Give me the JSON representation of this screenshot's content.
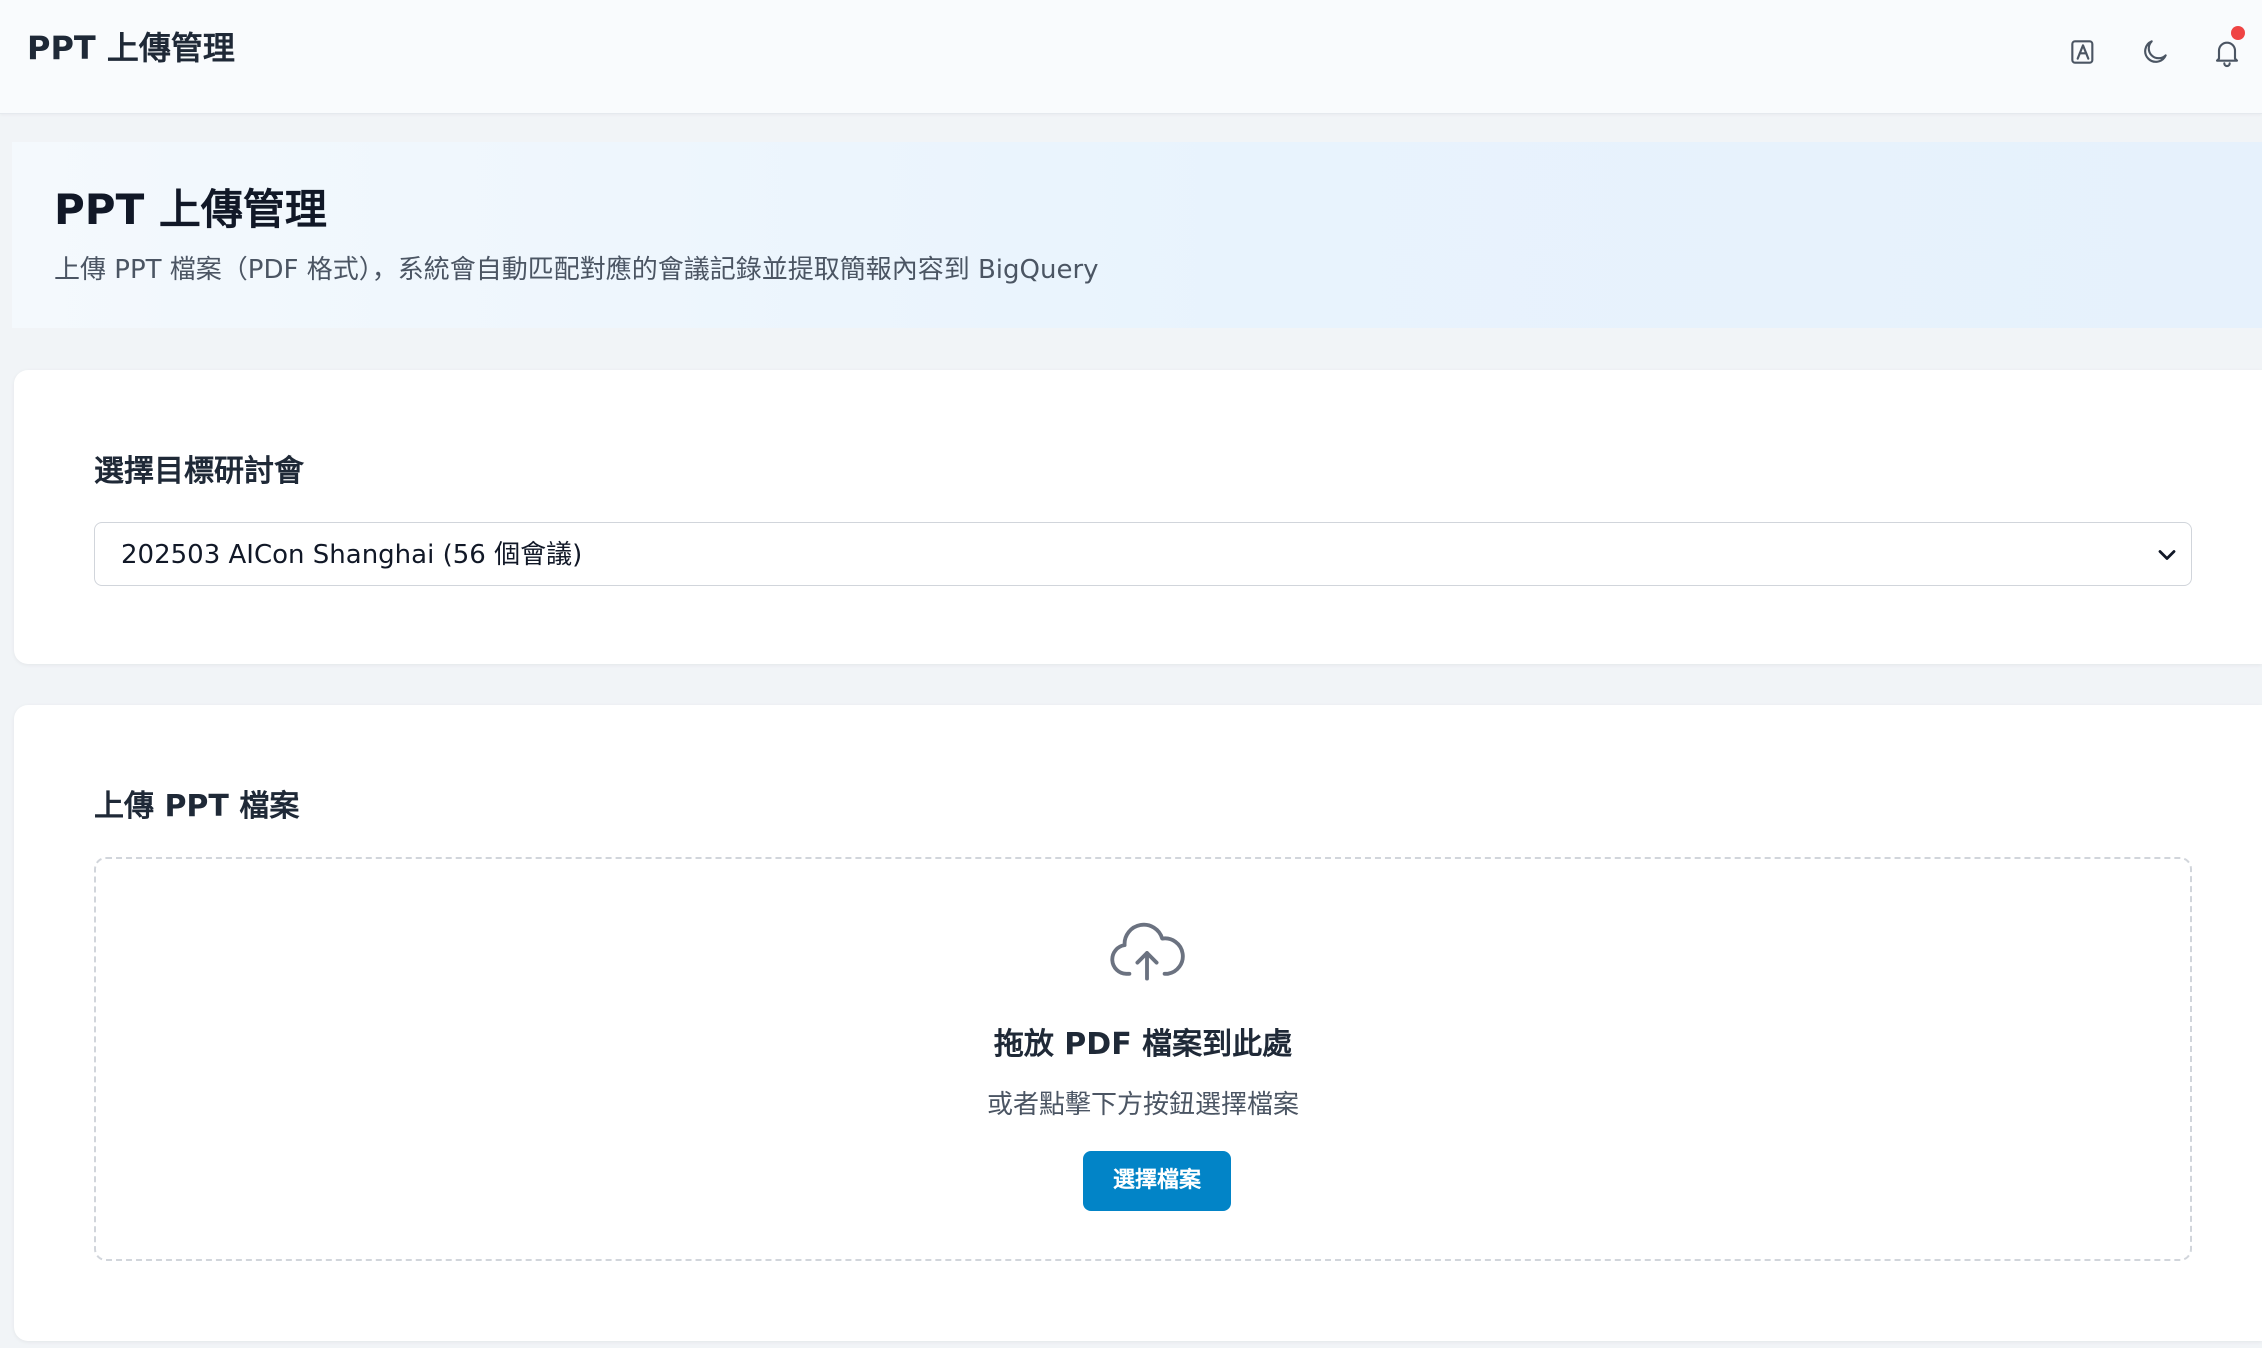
{
  "app": {
    "title": "PPT 上傳管理"
  },
  "header_icons": [
    {
      "name": "translate-icon"
    },
    {
      "name": "moon-icon"
    },
    {
      "name": "bell-icon",
      "has_notification": true
    }
  ],
  "hero": {
    "title": "PPT 上傳管理",
    "subtitle": "上傳 PPT 檔案（PDF 格式），系統會自動匹配對應的會議記錄並提取簡報內容到 BigQuery"
  },
  "seminar_select": {
    "label": "選擇目標研討會",
    "selected_value": "202503 AICon Shanghai (56 個會議)"
  },
  "upload": {
    "label": "上傳 PPT 檔案",
    "dropzone_title": "拖放 PDF 檔案到此處",
    "dropzone_hint": "或者點擊下方按鈕選擇檔案",
    "button_label": "選擇檔案"
  },
  "colors": {
    "accent": "#0284c7",
    "notification": "#ef4444",
    "background": "#f1f4f7"
  }
}
